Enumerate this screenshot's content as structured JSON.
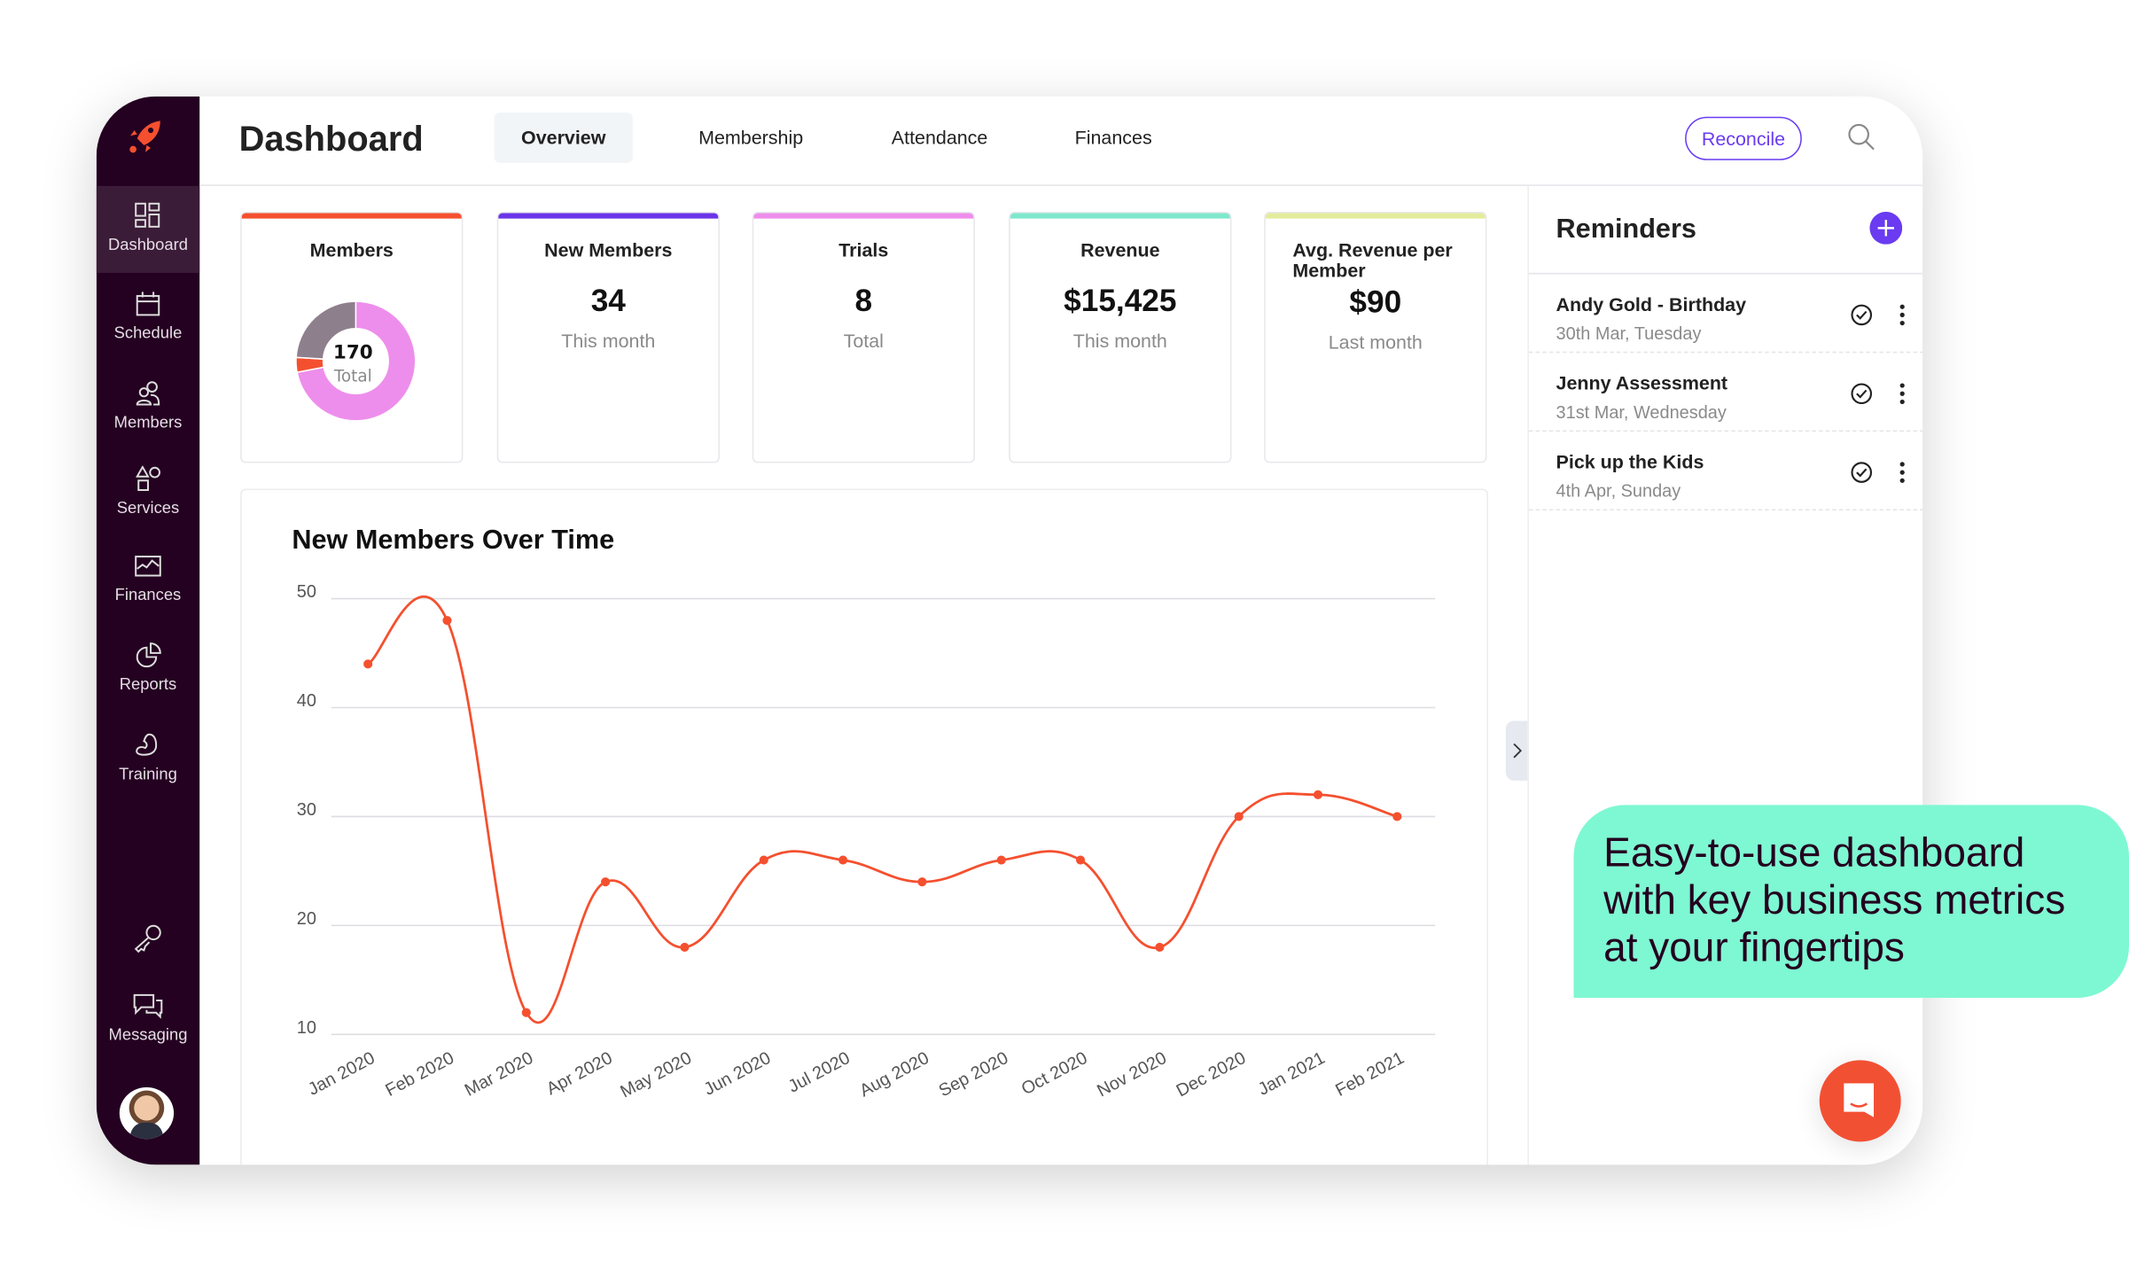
{
  "app": {
    "title": "Dashboard",
    "logo": "rocket-icon"
  },
  "sidebar": {
    "items": [
      {
        "label": "Dashboard",
        "icon": "grid-icon",
        "active": true
      },
      {
        "label": "Schedule",
        "icon": "calendar-icon"
      },
      {
        "label": "Members",
        "icon": "users-icon"
      },
      {
        "label": "Services",
        "icon": "shapes-icon"
      },
      {
        "label": "Finances",
        "icon": "chart-frame-icon"
      },
      {
        "label": "Reports",
        "icon": "pie-icon"
      },
      {
        "label": "Training",
        "icon": "muscle-icon"
      }
    ],
    "bottom": [
      {
        "label": "",
        "icon": "key-icon"
      },
      {
        "label": "Messaging",
        "icon": "chat-icon"
      }
    ],
    "avatar": "user-avatar"
  },
  "header": {
    "tabs": [
      "Overview",
      "Membership",
      "Attendance",
      "Finances"
    ],
    "active_tab": "Overview",
    "reconcile_label": "Reconcile",
    "accent": "#6a3bf0"
  },
  "cards": [
    {
      "title": "Members",
      "center_value": "170",
      "center_label": "Total",
      "color": "#f4502f",
      "donut": [
        {
          "fraction": 0.72,
          "color": "#ee8eec"
        },
        {
          "fraction": 0.04,
          "color": "#f4502f"
        },
        {
          "fraction": 0.24,
          "color": "#8e7f8d"
        }
      ]
    },
    {
      "title": "New Members",
      "value": "34",
      "sub": "This month",
      "color": "#6b35e8"
    },
    {
      "title": "Trials",
      "value": "8",
      "sub": "Total",
      "color": "#ee8eec"
    },
    {
      "title": "Revenue",
      "value": "$15,425",
      "sub": "This month",
      "color": "#7fe8cc"
    },
    {
      "title": "Avg. Revenue per Member",
      "value": "$90",
      "sub": "Last month",
      "color": "#e3ec9c"
    }
  ],
  "chart_data": {
    "type": "line",
    "title": "New Members Over Time",
    "xlabel": "",
    "ylabel": "",
    "categories": [
      "Jan 2020",
      "Feb 2020",
      "Mar 2020",
      "Apr 2020",
      "May 2020",
      "Jun 2020",
      "Jul 2020",
      "Aug 2020",
      "Sep 2020",
      "Oct 2020",
      "Nov 2020",
      "Dec 2020",
      "Jan 2021",
      "Feb 2021"
    ],
    "values": [
      44,
      48,
      12,
      24,
      18,
      26,
      26,
      24,
      26,
      26,
      18,
      30,
      32,
      30
    ],
    "ylim": [
      10,
      50
    ],
    "yticks": [
      10,
      20,
      30,
      40,
      50
    ],
    "grid": true,
    "color": "#f4502f",
    "smooth": true
  },
  "reminders": {
    "title": "Reminders",
    "items": [
      {
        "title": "Andy Gold - Birthday",
        "date": "30th Mar, Tuesday"
      },
      {
        "title": "Jenny Assessment",
        "date": "31st Mar, Wednesday"
      },
      {
        "title": "Pick up the Kids",
        "date": "4th Apr, Sunday"
      }
    ]
  },
  "callout": {
    "lines": [
      "Easy-to-use dashboard",
      "with key business metrics",
      "at your fingertips"
    ],
    "color": "#7ef8d2"
  },
  "chat_button": {
    "color": "#f25033"
  }
}
